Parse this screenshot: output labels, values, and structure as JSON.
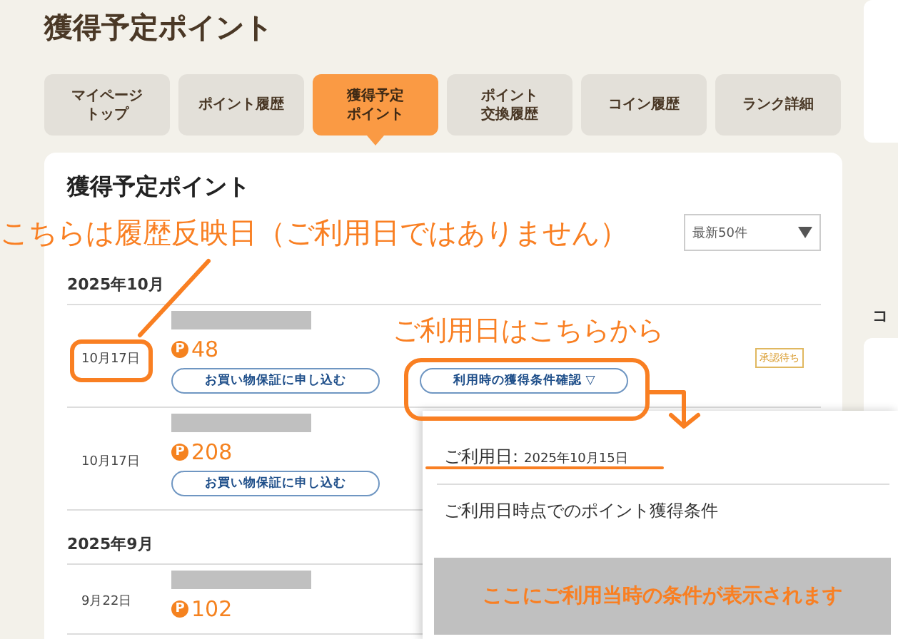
{
  "page_title": "獲得予定ポイント",
  "tabs": [
    {
      "lines": [
        "マイページ",
        "トップ"
      ],
      "selected": false
    },
    {
      "lines": [
        "ポイント履歴"
      ],
      "selected": false
    },
    {
      "lines": [
        "獲得予定",
        "ポイント"
      ],
      "selected": true
    },
    {
      "lines": [
        "ポイント",
        "交換履歴"
      ],
      "selected": false
    },
    {
      "lines": [
        "コイン履歴"
      ],
      "selected": false
    },
    {
      "lines": [
        "ランク詳細"
      ],
      "selected": false
    }
  ],
  "card": {
    "title": "獲得予定ポイント",
    "filter": {
      "value": "最新50件"
    },
    "groups": [
      {
        "month": "2025年10月",
        "entries": [
          {
            "date": "10月17日",
            "point_mark": "P",
            "points": "48",
            "guarantee_button": "お買い物保証に申し込む",
            "condition_button": "利用時の獲得条件確認 ▽",
            "status": "承認待ち"
          },
          {
            "date": "10月17日",
            "point_mark": "P",
            "points": "208",
            "guarantee_button": "お買い物保証に申し込む"
          }
        ]
      },
      {
        "month": "2025年9月",
        "entries": [
          {
            "date": "9月22日",
            "point_mark": "P",
            "points": "102"
          }
        ]
      }
    ]
  },
  "popup": {
    "usage_label": "ご利用日:",
    "usage_date": "2025年10月15日",
    "heading": "ご利用日時点でのポイント獲得条件",
    "notice": "ここにご利用当時の条件が表示されます"
  },
  "annotations": {
    "date_note": "こちらは履歴反映日（ご利用日ではありません）",
    "usage_note": "ご利用日はこちらから"
  },
  "sidebar": {
    "text": "コ"
  }
}
